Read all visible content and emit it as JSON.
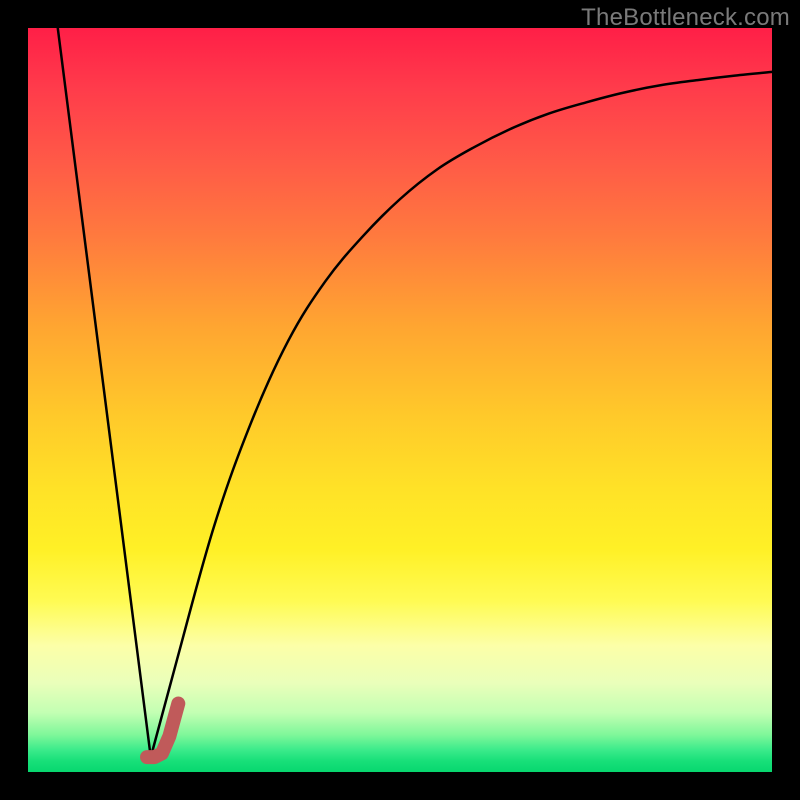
{
  "watermark": "TheBottleneck.com",
  "colors": {
    "background": "#000000",
    "curve_stroke": "#000000",
    "marker_stroke": "#c05a5a"
  },
  "chart_data": {
    "type": "line",
    "title": "",
    "xlabel": "",
    "ylabel": "",
    "xlim": [
      0,
      100
    ],
    "ylim": [
      0,
      100
    ],
    "grid": false,
    "series": [
      {
        "name": "left-descending-segment",
        "x": [
          4,
          16.5
        ],
        "y": [
          100,
          2
        ]
      },
      {
        "name": "right-rising-curve",
        "x": [
          16.5,
          20,
          25,
          30,
          35,
          40,
          45,
          50,
          55,
          60,
          65,
          70,
          75,
          80,
          85,
          90,
          95,
          100
        ],
        "y": [
          2,
          15,
          33,
          47,
          58,
          66,
          72,
          77,
          81,
          84,
          86.5,
          88.5,
          90,
          91.3,
          92.3,
          93,
          93.6,
          94.1
        ]
      }
    ],
    "marker": {
      "name": "optimal-point-marker",
      "points_xy": [
        [
          16.0,
          2.0
        ],
        [
          17.0,
          2.0
        ],
        [
          18.0,
          2.5
        ],
        [
          19.0,
          4.8
        ],
        [
          19.6,
          7.0
        ],
        [
          20.2,
          9.2
        ]
      ],
      "stroke_width_px": 14
    }
  }
}
